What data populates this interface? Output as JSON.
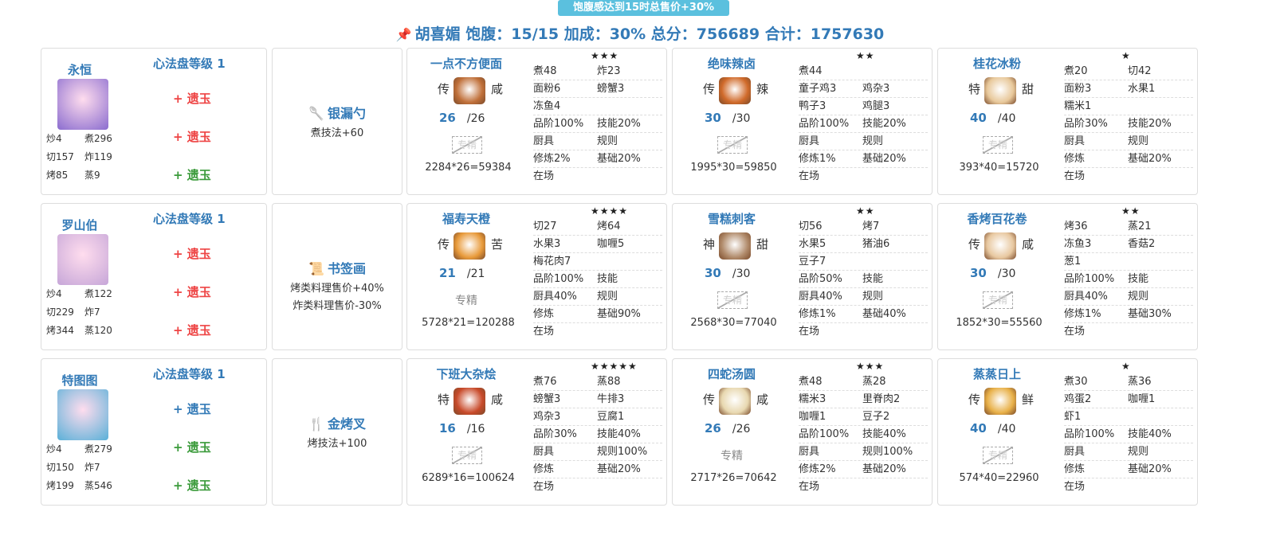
{
  "banner": "饱腹感达到15时总售价+30%",
  "headline": {
    "chef": "胡喜媚",
    "text": "饱腹：15/15 加成：30% 总分：756689 合计：1757630"
  },
  "rows": [
    {
      "chef": {
        "name": "永恒",
        "level": "心法盘等级 1",
        "avatar_color": "#8a6ccf",
        "stats": [
          [
            "炒4",
            "煮296"
          ],
          [
            "切157",
            "炸119"
          ],
          [
            "烤85",
            "蒸9"
          ]
        ],
        "jades": [
          {
            "text": "+ 遗玉",
            "color": "red"
          },
          {
            "text": "+ 遗玉",
            "color": "red"
          },
          {
            "text": "+ 遗玉",
            "color": "green"
          }
        ]
      },
      "equip": {
        "icon": "spoon-icon",
        "glyph": "🥄",
        "name": "银漏勺",
        "effects": [
          "煮技法+60"
        ]
      },
      "dishes": [
        {
          "name": "一点不方便面",
          "rarity": "★★★",
          "grade": "传",
          "taste": "咸",
          "img": "#c0703a",
          "n": "26",
          "d": "/26",
          "special": "专精",
          "special_style": "crossed",
          "score": "2284*26=59384",
          "grid": [
            [
              "煮48",
              "炸23"
            ],
            [
              "面粉6",
              "螃蟹3"
            ],
            [
              "冻鱼4",
              ""
            ],
            [
              "品阶100%",
              "技能20%"
            ],
            [
              "厨具",
              "规则"
            ],
            [
              "修炼2%",
              "基础20%"
            ],
            [
              "在场",
              ""
            ]
          ]
        },
        {
          "name": "绝味辣卤",
          "rarity": "★★",
          "grade": "传",
          "taste": "辣",
          "img": "#d06a2a",
          "n": "30",
          "d": "/30",
          "special": "专精",
          "special_style": "crossed",
          "score": "1995*30=59850",
          "grid": [
            [
              "煮44",
              ""
            ],
            [
              "童子鸡3",
              "鸡杂3"
            ],
            [
              "鸭子3",
              "鸡腿3"
            ],
            [
              "品阶100%",
              "技能20%"
            ],
            [
              "厨具",
              "规则"
            ],
            [
              "修炼1%",
              "基础20%"
            ],
            [
              "在场",
              ""
            ]
          ]
        },
        {
          "name": "桂花冰粉",
          "rarity": "★",
          "grade": "特",
          "taste": "甜",
          "img": "#e8c89a",
          "n": "40",
          "d": "/40",
          "special": "专精",
          "special_style": "crossed",
          "score": "393*40=15720",
          "grid": [
            [
              "煮20",
              "切42"
            ],
            [
              "面粉3",
              "水果1"
            ],
            [
              "糯米1",
              ""
            ],
            [
              "品阶30%",
              "技能20%"
            ],
            [
              "厨具",
              "规则"
            ],
            [
              "修炼",
              "基础20%"
            ],
            [
              "在场",
              ""
            ]
          ]
        }
      ]
    },
    {
      "chef": {
        "name": "罗山伯",
        "level": "心法盘等级 1",
        "avatar_color": "#c6a6d8",
        "stats": [
          [
            "炒4",
            "煮122"
          ],
          [
            "切229",
            "炸7"
          ],
          [
            "烤344",
            "蒸120"
          ]
        ],
        "jades": [
          {
            "text": "+ 遗玉",
            "color": "red"
          },
          {
            "text": "+ 遗玉",
            "color": "red"
          },
          {
            "text": "+ 遗玉",
            "color": "red"
          }
        ]
      },
      "equip": {
        "icon": "bookmark-icon",
        "glyph": "📜",
        "name": "书签画",
        "effects": [
          "烤类料理售价+40%",
          "炸类料理售价-30%"
        ]
      },
      "dishes": [
        {
          "name": "福寿天橙",
          "rarity": "★★★★",
          "grade": "传",
          "taste": "苦",
          "img": "#e89a3a",
          "n": "21",
          "d": "/21",
          "special": "专精",
          "special_style": "plain",
          "score": "5728*21=120288",
          "grid": [
            [
              "切27",
              "烤64"
            ],
            [
              "水果3",
              "咖喱5"
            ],
            [
              "梅花肉7",
              ""
            ],
            [
              "品阶100%",
              "技能"
            ],
            [
              "厨具40%",
              "规则"
            ],
            [
              "修炼",
              "基础90%"
            ],
            [
              "在场",
              ""
            ]
          ]
        },
        {
          "name": "雪糕刺客",
          "rarity": "★★",
          "grade": "神",
          "taste": "甜",
          "img": "#b08a6a",
          "n": "30",
          "d": "/30",
          "special": "专精",
          "special_style": "crossed",
          "score": "2568*30=77040",
          "grid": [
            [
              "切56",
              "烤7"
            ],
            [
              "水果5",
              "猪油6"
            ],
            [
              "豆子7",
              ""
            ],
            [
              "品阶50%",
              "技能"
            ],
            [
              "厨具40%",
              "规则"
            ],
            [
              "修炼1%",
              "基础40%"
            ],
            [
              "在场",
              ""
            ]
          ]
        },
        {
          "name": "香烤百花卷",
          "rarity": "★★",
          "grade": "传",
          "taste": "咸",
          "img": "#e8c8a0",
          "n": "30",
          "d": "/30",
          "special": "专精",
          "special_style": "crossed",
          "score": "1852*30=55560",
          "grid": [
            [
              "烤36",
              "蒸21"
            ],
            [
              "冻鱼3",
              "香菇2"
            ],
            [
              "葱1",
              ""
            ],
            [
              "品阶100%",
              "技能"
            ],
            [
              "厨具40%",
              "规则"
            ],
            [
              "修炼1%",
              "基础30%"
            ],
            [
              "在场",
              ""
            ]
          ]
        }
      ]
    },
    {
      "chef": {
        "name": "特图图",
        "level": "心法盘等级 1",
        "avatar_color": "#5ab0d8",
        "stats": [
          [
            "炒4",
            "煮279"
          ],
          [
            "切150",
            "炸7"
          ],
          [
            "烤199",
            "蒸546"
          ]
        ],
        "jades": [
          {
            "text": "+ 遗玉",
            "color": "blue"
          },
          {
            "text": "+ 遗玉",
            "color": "green"
          },
          {
            "text": "+ 遗玉",
            "color": "green"
          }
        ]
      },
      "equip": {
        "icon": "fork-icon",
        "glyph": "🍴",
        "name": "金烤叉",
        "effects": [
          "烤技法+100"
        ]
      },
      "dishes": [
        {
          "name": "下班大杂烩",
          "rarity": "★★★★★",
          "grade": "特",
          "taste": "咸",
          "img": "#c84a2a",
          "n": "16",
          "d": "/16",
          "special": "专精",
          "special_style": "crossed",
          "score": "6289*16=100624",
          "grid": [
            [
              "煮76",
              "蒸88"
            ],
            [
              "螃蟹3",
              "牛排3"
            ],
            [
              "鸡杂3",
              "豆腐1"
            ],
            [
              "品阶30%",
              "技能40%"
            ],
            [
              "厨具",
              "规则100%"
            ],
            [
              "修炼",
              "基础20%"
            ],
            [
              "在场",
              ""
            ]
          ]
        },
        {
          "name": "四蛇汤圆",
          "rarity": "★★★",
          "grade": "传",
          "taste": "咸",
          "img": "#e8d8b0",
          "n": "26",
          "d": "/26",
          "special": "专精",
          "special_style": "plain",
          "score": "2717*26=70642",
          "grid": [
            [
              "煮48",
              "蒸28"
            ],
            [
              "糯米3",
              "里脊肉2"
            ],
            [
              "咖喱1",
              "豆子2"
            ],
            [
              "品阶100%",
              "技能40%"
            ],
            [
              "厨具",
              "规则100%"
            ],
            [
              "修炼2%",
              "基础20%"
            ],
            [
              "在场",
              ""
            ]
          ]
        },
        {
          "name": "蒸蒸日上",
          "rarity": "★",
          "grade": "传",
          "taste": "鲜",
          "img": "#e8b048",
          "n": "40",
          "d": "/40",
          "special": "专精",
          "special_style": "crossed",
          "score": "574*40=22960",
          "grid": [
            [
              "煮30",
              "蒸36"
            ],
            [
              "鸡蛋2",
              "咖喱1"
            ],
            [
              "虾1",
              ""
            ],
            [
              "品阶100%",
              "技能40%"
            ],
            [
              "厨具",
              "规则"
            ],
            [
              "修炼",
              "基础20%"
            ],
            [
              "在场",
              ""
            ]
          ]
        }
      ]
    }
  ]
}
